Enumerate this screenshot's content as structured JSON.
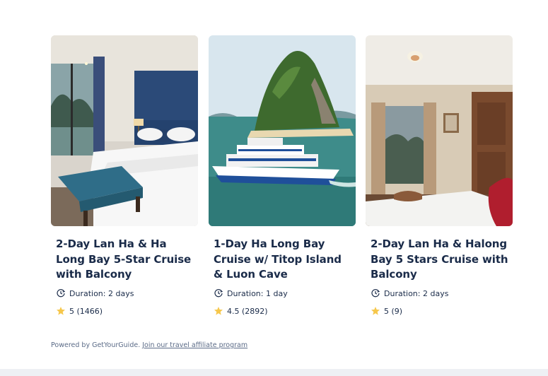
{
  "colors": {
    "text_primary": "#1a2b49",
    "text_secondary": "#5b6b87",
    "star": "#f6c74b"
  },
  "cards": [
    {
      "title": "2-Day Lan Ha & Ha Long Bay 5-Star Cruise with Balcony",
      "duration_label": "Duration:",
      "duration_value": "2 days",
      "rating_value": "5",
      "rating_count": "(1466)",
      "image": "cruise-cabin-bed-photo"
    },
    {
      "title": "1-Day Ha Long Bay Cruise w/ Titop Island & Luon Cave",
      "duration_label": "Duration:",
      "duration_value": "1 day",
      "rating_value": "4.5",
      "rating_count": "(2892)",
      "image": "cruise-ship-island-photo"
    },
    {
      "title": "2-Day Lan Ha & Halong Bay 5 Stars Cruise with Balcony",
      "duration_label": "Duration:",
      "duration_value": "2 days",
      "rating_value": "5",
      "rating_count": "(9)",
      "image": "cruise-cabin-room-photo"
    }
  ],
  "footer": {
    "powered_text": "Powered by GetYourGuide.",
    "affiliate_link": "Join our travel affiliate program"
  }
}
